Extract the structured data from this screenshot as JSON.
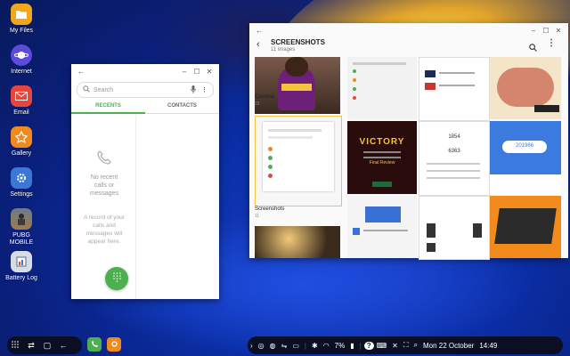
{
  "desktop": {
    "icons": [
      {
        "label": "My Files",
        "icon": "folder-icon",
        "color": "#f2a71b"
      },
      {
        "label": "Internet",
        "icon": "planet-icon",
        "color": "#5b4bd6"
      },
      {
        "label": "Email",
        "icon": "envelope-icon",
        "color": "#e6463e"
      },
      {
        "label": "Gallery",
        "icon": "flower-icon",
        "color": "#f08a1c"
      },
      {
        "label": "Settings",
        "icon": "gear-icon",
        "color": "#3c77d6"
      },
      {
        "label": "PUBG MOBILE",
        "icon": "pubg-icon",
        "color": "#a07a4a"
      },
      {
        "label": "Battery Log",
        "icon": "battery-log-icon",
        "color": "#d6dbe6"
      }
    ]
  },
  "phone": {
    "search_placeholder": "Search",
    "tabs": [
      "RECENTS",
      "CONTACTS"
    ],
    "empty_title": "No recent calls or messages",
    "empty_body": "A record of your calls and messages will appear here.",
    "accent": "#4caf50"
  },
  "gallery": {
    "title": "SCREENSHOTS",
    "count": "11 images",
    "albums": [
      {
        "name": "Camera",
        "count": "15"
      },
      {
        "name": "Screenshots",
        "count": "11"
      }
    ],
    "victory_text": "VICTORY",
    "final_review": "Final Review",
    "score_top": "1854",
    "score_bottom": "6363",
    "wifi_value": "201966"
  },
  "taskbar": {
    "battery": "7%",
    "date": "Mon 22 October",
    "time": "14:49"
  }
}
